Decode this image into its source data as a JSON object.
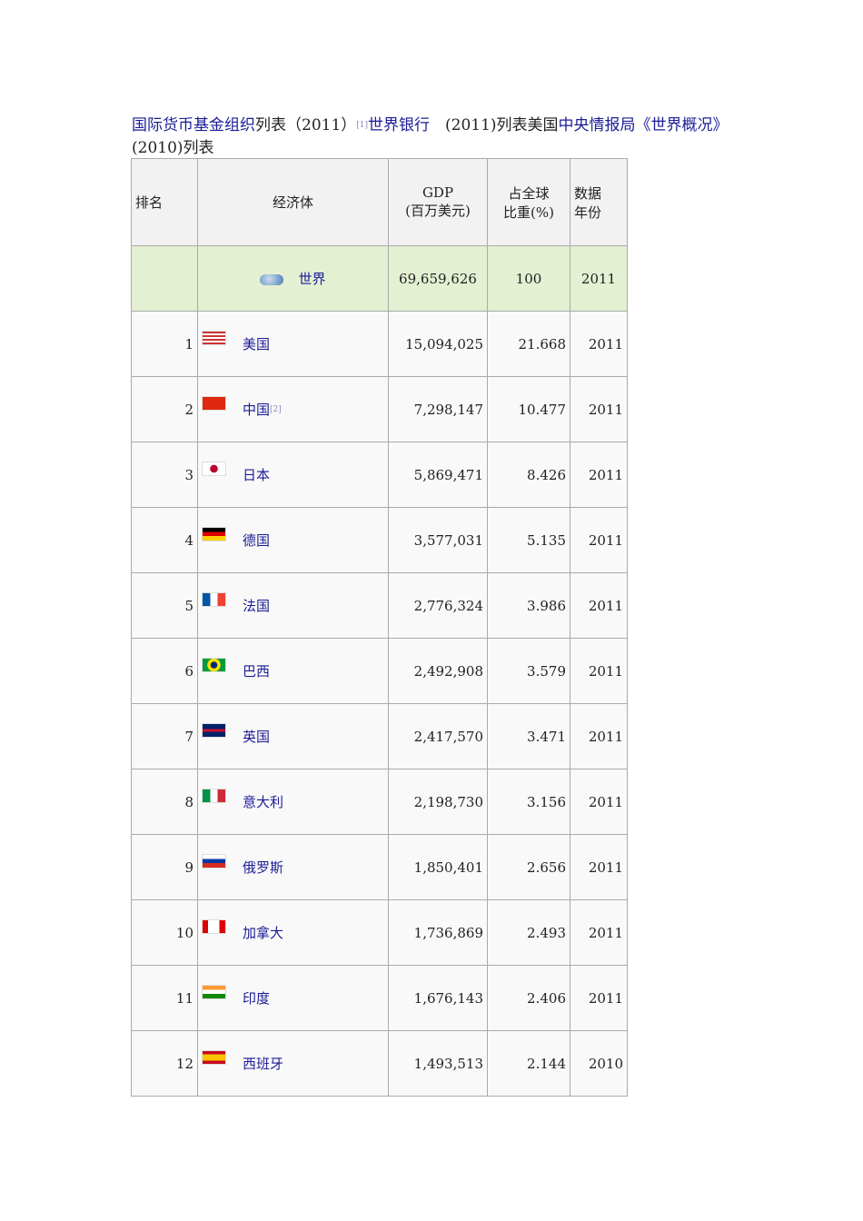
{
  "title": {
    "link1": "国际货币基金组织",
    "t1": "列表（2011）",
    "ref1": "[1]",
    "link2": "世界银行",
    "t2": "　(2011)列表美国",
    "link3": "中央情报局《世界概况》",
    "t3": "　(2010)列表"
  },
  "headers": {
    "rank": "排名",
    "economy": "经济体",
    "gdp_line1": "GDP",
    "gdp_line2": "(百万美元)",
    "share_line1": "占全球",
    "share_line2": "比重(%)",
    "year_line1": "数据",
    "year_line2": "年份"
  },
  "world": {
    "name": "世界",
    "gdp": "69,659,626",
    "share": "100",
    "year": "2011",
    "icon": "globe-icon"
  },
  "rows": [
    {
      "rank": "1",
      "name": "美国",
      "ref": "",
      "gdp": "15,094,025",
      "share": "21.668",
      "year": "2011",
      "flag": "us"
    },
    {
      "rank": "2",
      "name": "中国",
      "ref": "[2]",
      "gdp": "7,298,147",
      "share": "10.477",
      "year": "2011",
      "flag": "cn"
    },
    {
      "rank": "3",
      "name": "日本",
      "ref": "",
      "gdp": "5,869,471",
      "share": "8.426",
      "year": "2011",
      "flag": "jp"
    },
    {
      "rank": "4",
      "name": "德国",
      "ref": "",
      "gdp": "3,577,031",
      "share": "5.135",
      "year": "2011",
      "flag": "de"
    },
    {
      "rank": "5",
      "name": "法国",
      "ref": "",
      "gdp": "2,776,324",
      "share": "3.986",
      "year": "2011",
      "flag": "fr"
    },
    {
      "rank": "6",
      "name": "巴西",
      "ref": "",
      "gdp": "2,492,908",
      "share": "3.579",
      "year": "2011",
      "flag": "br"
    },
    {
      "rank": "7",
      "name": "英国",
      "ref": "",
      "gdp": "2,417,570",
      "share": "3.471",
      "year": "2011",
      "flag": "gb"
    },
    {
      "rank": "8",
      "name": "意大利",
      "ref": "",
      "gdp": "2,198,730",
      "share": "3.156",
      "year": "2011",
      "flag": "it"
    },
    {
      "rank": "9",
      "name": "俄罗斯",
      "ref": "",
      "gdp": "1,850,401",
      "share": "2.656",
      "year": "2011",
      "flag": "ru"
    },
    {
      "rank": "10",
      "name": "加拿大",
      "ref": "",
      "gdp": "1,736,869",
      "share": "2.493",
      "year": "2011",
      "flag": "ca"
    },
    {
      "rank": "11",
      "name": "印度",
      "ref": "",
      "gdp": "1,676,143",
      "share": "2.406",
      "year": "2011",
      "flag": "in"
    },
    {
      "rank": "12",
      "name": "西班牙",
      "ref": "",
      "gdp": "1,493,513",
      "share": "2.144",
      "year": "2010",
      "flag": "es"
    }
  ]
}
